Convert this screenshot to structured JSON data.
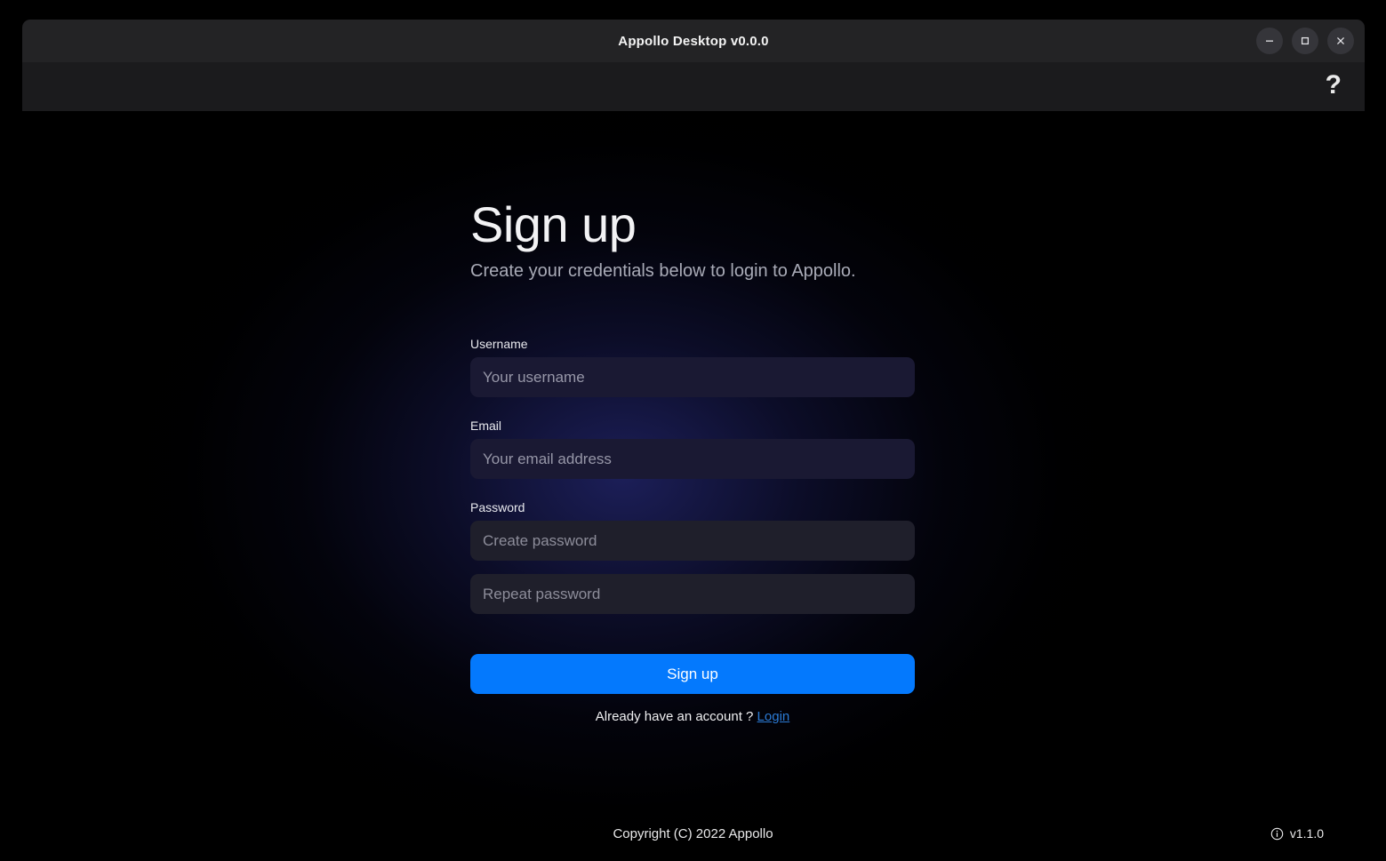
{
  "window": {
    "title": "Appollo Desktop v0.0.0",
    "controls": [
      {
        "name": "minimize",
        "glyph": "minimize-icon",
        "label": "Minimize"
      },
      {
        "name": "maximize",
        "glyph": "maximize-icon",
        "label": "Maximize"
      },
      {
        "name": "close",
        "glyph": "close-icon",
        "label": "Close"
      }
    ]
  },
  "toolbar": {
    "help_icon": "question-mark-icon",
    "help_label": "?"
  },
  "main": {
    "title": "Sign up",
    "subtitle": "Create your credentials below to login to Appollo.",
    "fields": [
      {
        "label": "Username",
        "placeholder": "Your username",
        "value": "",
        "type": "text"
      },
      {
        "label": "Email",
        "placeholder": "Your email address",
        "value": "",
        "type": "text"
      },
      {
        "label": "Password",
        "placeholder": "Create password",
        "value": "",
        "type": "password"
      },
      {
        "label": "",
        "placeholder": "Repeat password",
        "value": "",
        "type": "password"
      }
    ],
    "submit_label": "Sign up",
    "login_prompt": "Already have an account ?",
    "login_link": "Login"
  },
  "footer": {
    "copyright": "Copyright (C) 2022 Appollo",
    "version": "v1.1.0",
    "info_icon": "info-circle-icon"
  },
  "colors": {
    "accent": "#0479fd",
    "link": "#2b7bd6",
    "titlebar": "#232325",
    "toolbar": "#1b1b1d",
    "input_bg": "#1a1933",
    "password_input_bg": "#1f1f2b",
    "background": "#000000",
    "glow": "#212468"
  }
}
